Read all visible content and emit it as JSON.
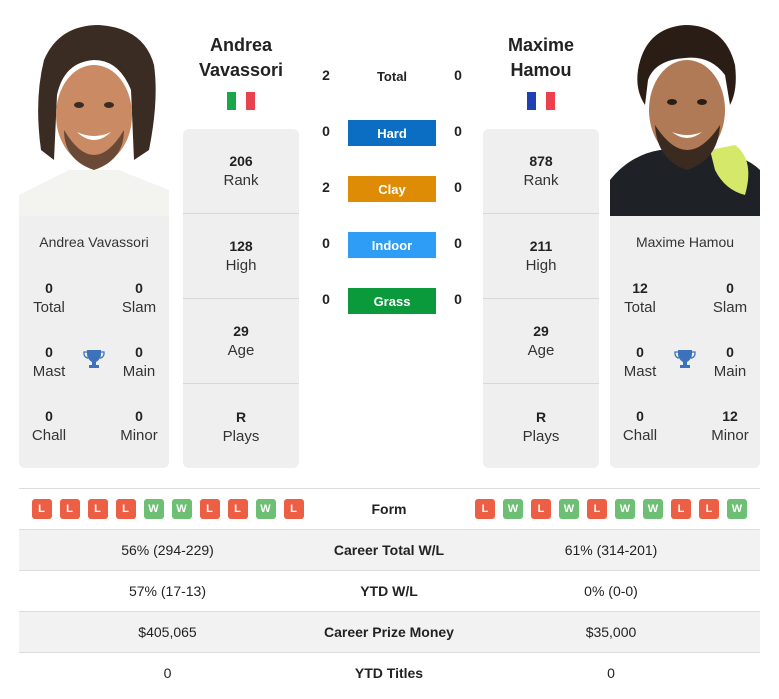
{
  "colors": {
    "hard": "#0b6ec2",
    "clay": "#de8c06",
    "indoor": "#2e9df5",
    "grass": "#0a9a3c",
    "loss": "#ec5f45",
    "win": "#6cbf73",
    "trophy": "#3c72bb"
  },
  "player1": {
    "name_line1": "Andrea",
    "name_line2": "Vavassori",
    "full_name": "Andrea Vavassori",
    "flag": "italy-flag",
    "flag_colors": [
      "#1aa64a",
      "#ffffff",
      "#e8424f"
    ],
    "stats": [
      {
        "value": "206",
        "label": "Rank"
      },
      {
        "value": "128",
        "label": "High"
      },
      {
        "value": "29",
        "label": "Age"
      },
      {
        "value": "R",
        "label": "Plays"
      }
    ],
    "titles": {
      "total": {
        "value": "0",
        "label": "Total"
      },
      "slam": {
        "value": "0",
        "label": "Slam"
      },
      "mast": {
        "value": "0",
        "label": "Mast"
      },
      "main": {
        "value": "0",
        "label": "Main"
      },
      "chall": {
        "value": "0",
        "label": "Chall"
      },
      "minor": {
        "value": "0",
        "label": "Minor"
      }
    }
  },
  "player2": {
    "name_line1": "Maxime",
    "name_line2": "Hamou",
    "full_name": "Maxime Hamou",
    "flag": "france-flag",
    "flag_colors": [
      "#1f3fb5",
      "#ffffff",
      "#ee3f4f"
    ],
    "stats": [
      {
        "value": "878",
        "label": "Rank"
      },
      {
        "value": "211",
        "label": "High"
      },
      {
        "value": "29",
        "label": "Age"
      },
      {
        "value": "R",
        "label": "Plays"
      }
    ],
    "titles": {
      "total": {
        "value": "12",
        "label": "Total"
      },
      "slam": {
        "value": "0",
        "label": "Slam"
      },
      "mast": {
        "value": "0",
        "label": "Mast"
      },
      "main": {
        "value": "0",
        "label": "Main"
      },
      "chall": {
        "value": "0",
        "label": "Chall"
      },
      "minor": {
        "value": "12",
        "label": "Minor"
      }
    }
  },
  "h2h": {
    "total": {
      "label": "Total",
      "p1": "2",
      "p2": "0"
    },
    "surfaces": [
      {
        "label": "Hard",
        "p1": "0",
        "p2": "0",
        "color": "#0b6ec2"
      },
      {
        "label": "Clay",
        "p1": "2",
        "p2": "0",
        "color": "#de8c06"
      },
      {
        "label": "Indoor",
        "p1": "0",
        "p2": "0",
        "color": "#2e9df5"
      },
      {
        "label": "Grass",
        "p1": "0",
        "p2": "0",
        "color": "#0a9a3c"
      }
    ]
  },
  "comparison": {
    "form": {
      "label": "Form",
      "p1": [
        "L",
        "L",
        "L",
        "L",
        "W",
        "W",
        "L",
        "L",
        "W",
        "L"
      ],
      "p2": [
        "L",
        "W",
        "L",
        "W",
        "L",
        "W",
        "W",
        "L",
        "L",
        "W"
      ]
    },
    "rows": [
      {
        "label": "Career Total W/L",
        "p1": "56% (294-229)",
        "p2": "61% (314-201)"
      },
      {
        "label": "YTD W/L",
        "p1": "57% (17-13)",
        "p2": "0% (0-0)"
      },
      {
        "label": "Career Prize Money",
        "p1": "$405,065",
        "p2": "$35,000"
      },
      {
        "label": "YTD Titles",
        "p1": "0",
        "p2": "0"
      }
    ]
  }
}
